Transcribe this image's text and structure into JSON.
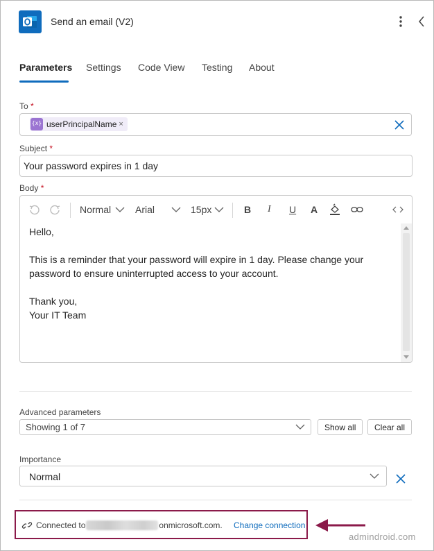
{
  "header": {
    "title": "Send an email (V2)",
    "app_icon": "outlook-icon",
    "more_icon": "more-vertical-icon",
    "back_icon": "chevron-left-icon"
  },
  "tabs": [
    {
      "label": "Parameters",
      "active": true
    },
    {
      "label": "Settings",
      "active": false
    },
    {
      "label": "Code View",
      "active": false
    },
    {
      "label": "Testing",
      "active": false
    },
    {
      "label": "About",
      "active": false
    }
  ],
  "fields": {
    "to": {
      "label": "To",
      "required_mark": "*",
      "token": "userPrincipalName",
      "token_remove": "×"
    },
    "subject": {
      "label": "Subject",
      "required_mark": "*",
      "value": "Your password expires in 1 day"
    },
    "body": {
      "label": "Body",
      "required_mark": "*",
      "toolbar": {
        "paragraph_style": "Normal",
        "font": "Arial",
        "font_size": "15px",
        "bold": "B",
        "italic": "I",
        "underline": "U",
        "font_color": "A"
      },
      "lines": [
        "Hello,",
        "",
        "This is a reminder that your password will expire in 1 day. Please change your password to ensure uninterrupted access to your account.",
        "",
        "Thank you,",
        "Your IT Team"
      ]
    }
  },
  "advanced": {
    "label": "Advanced parameters",
    "selected": "Showing 1 of 7",
    "show_all": "Show all",
    "clear_all": "Clear all"
  },
  "importance": {
    "label": "Importance",
    "value": "Normal"
  },
  "connection": {
    "prefix": "Connected to",
    "suffix": "onmicrosoft.com.",
    "change_link": "Change connection"
  },
  "watermark": "admindroid.com",
  "colors": {
    "accent": "#0f6cbd",
    "required": "#c50f1f",
    "highlight_box": "#8b1a4a",
    "token_bg": "#f0ecf8",
    "token_icon": "#9b74d2"
  }
}
